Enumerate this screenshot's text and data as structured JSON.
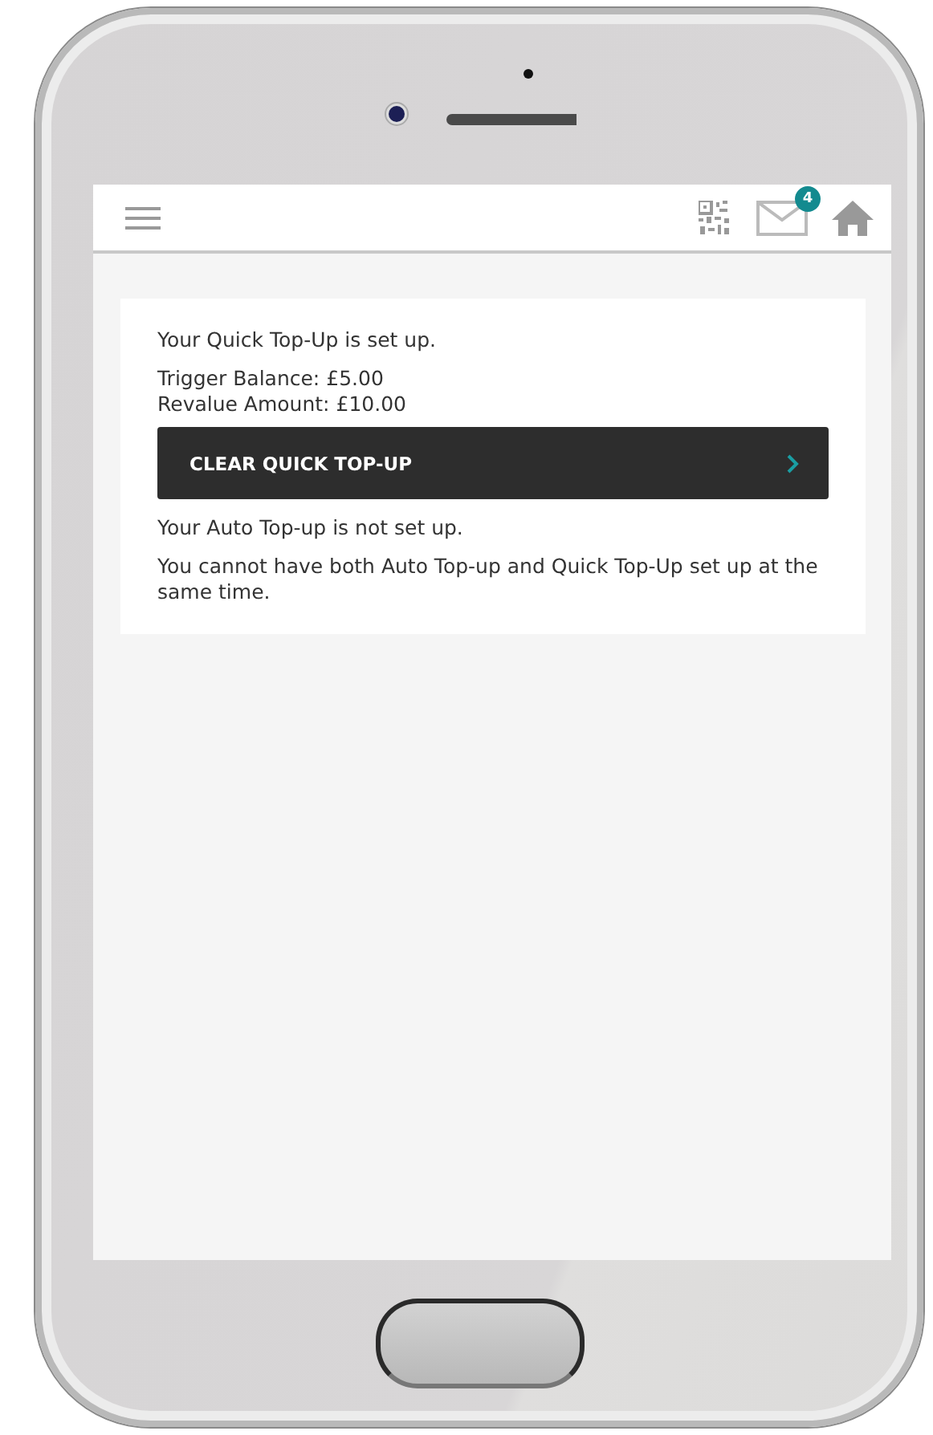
{
  "header": {
    "messages_badge": "4"
  },
  "quick_top_up": {
    "status": "Your Quick Top-Up is set up.",
    "trigger_balance": "Trigger Balance: £5.00",
    "revalue_amount": "Revalue Amount: £10.00",
    "clear_button": "CLEAR QUICK TOP-UP"
  },
  "auto_top_up": {
    "status": "Your Auto Top-up is not set up.",
    "note": "You cannot have both Auto Top-up and Quick Top-Up set up at the same time."
  }
}
